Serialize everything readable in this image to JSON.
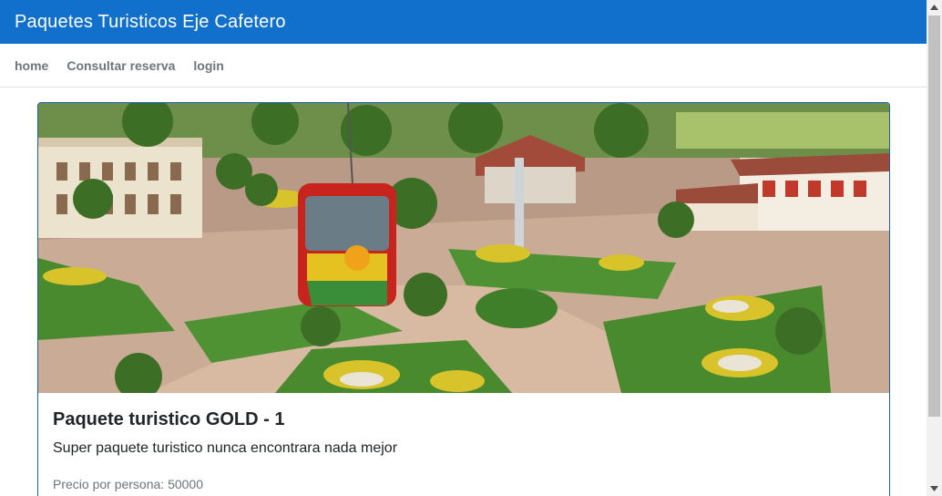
{
  "header": {
    "title": "Paquetes Turisticos Eje Cafetero"
  },
  "nav": {
    "items": [
      {
        "label": "home"
      },
      {
        "label": "Consultar reserva"
      },
      {
        "label": "login"
      }
    ]
  },
  "package": {
    "title": "Paquete turistico GOLD - 1",
    "description": "Super paquete turistico nunca encontrara nada mejor",
    "price": "Precio por persona: 50000"
  },
  "colors": {
    "header_bg": "#1070cb",
    "card_border": "#1a5fb4",
    "nav_text": "#6c757d"
  }
}
